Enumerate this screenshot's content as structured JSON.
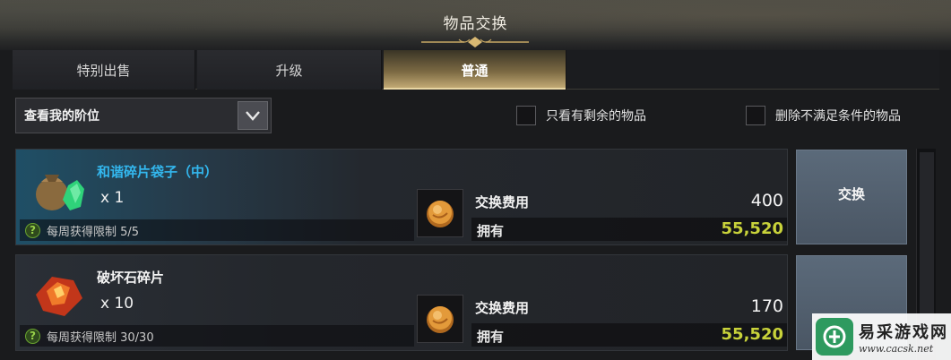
{
  "window": {
    "title": "物品交换"
  },
  "tabs": [
    {
      "label": "特别出售",
      "active": false
    },
    {
      "label": "升级",
      "active": false
    },
    {
      "label": "普通",
      "active": true
    }
  ],
  "filter": {
    "select_value": "查看我的阶位",
    "checkbox_remaining": "只看有剩余的物品",
    "checkbox_remove_unmet": "删除不满足条件的物品"
  },
  "items": [
    {
      "name": "和谐碎片袋子（中）",
      "qty": "x 1",
      "limit": "每周获得限制 5/5",
      "cost_label": "交换费用",
      "cost": "400",
      "own_label": "拥有",
      "own": "55,520",
      "button": "交换",
      "icon": "shard-pouch-icon"
    },
    {
      "name": "破坏石碎片",
      "qty": "x 10",
      "limit": "每周获得限制 30/30",
      "cost_label": "交换费用",
      "cost": "170",
      "own_label": "拥有",
      "own": "55,520",
      "button": "",
      "icon": "destruction-stone-icon"
    }
  ],
  "watermark": {
    "title": "易采游戏网",
    "url": "www.cacsk.net"
  },
  "colors": {
    "accent_gold": "#c9b07a",
    "highlight_name": "#33b7ee",
    "own_value": "#c8d23a"
  }
}
